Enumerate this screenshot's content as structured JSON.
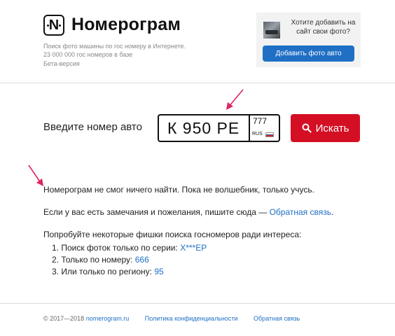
{
  "header": {
    "logo_letter": "N",
    "brand": "Номерограм",
    "tagline_1": "Поиск фото машины по гос номеру в Интернете.",
    "tagline_2": "23 000 000 гос номеров в базе",
    "beta": "Бета-версия"
  },
  "promo": {
    "text": "Хотите добавить на сайт свои фото?",
    "button": "Добавить фото авто"
  },
  "search": {
    "label": "Введите номер авто",
    "plate_number": "К 950 РЕ",
    "plate_region": "777",
    "plate_country": "RUS",
    "button": "Искать"
  },
  "result": {
    "not_found": "Номерограм не смог ничего найти. Пока не волшебник, только учусь.",
    "feedback_text": "Если у вас есть замечания и пожелания, пишите сюда — ",
    "feedback_link": "Обратная связь",
    "feedback_end": ".",
    "tips_intro": "Попробуйте некоторые фишки поиска госномеров ради интереса:",
    "tips": [
      {
        "text": "1. Поиск фоток только по серии: ",
        "link": "Х***ЕР"
      },
      {
        "text": "2. Только по номеру: ",
        "link": "666"
      },
      {
        "text": "3. Или только по региону: ",
        "link": "95"
      }
    ]
  },
  "footer": {
    "copyright": "© 2017—2018 ",
    "site_link": "nomerogram.ru",
    "privacy_link": "Политика конфиденциальности",
    "feedback_link": "Обратная связь"
  },
  "colors": {
    "accent_blue": "#1f6fc5",
    "search_red": "#d40f24",
    "annotation_arrow": "#e0245e"
  },
  "icons": [
    "magnifier-icon",
    "annotation-arrow-icon"
  ]
}
